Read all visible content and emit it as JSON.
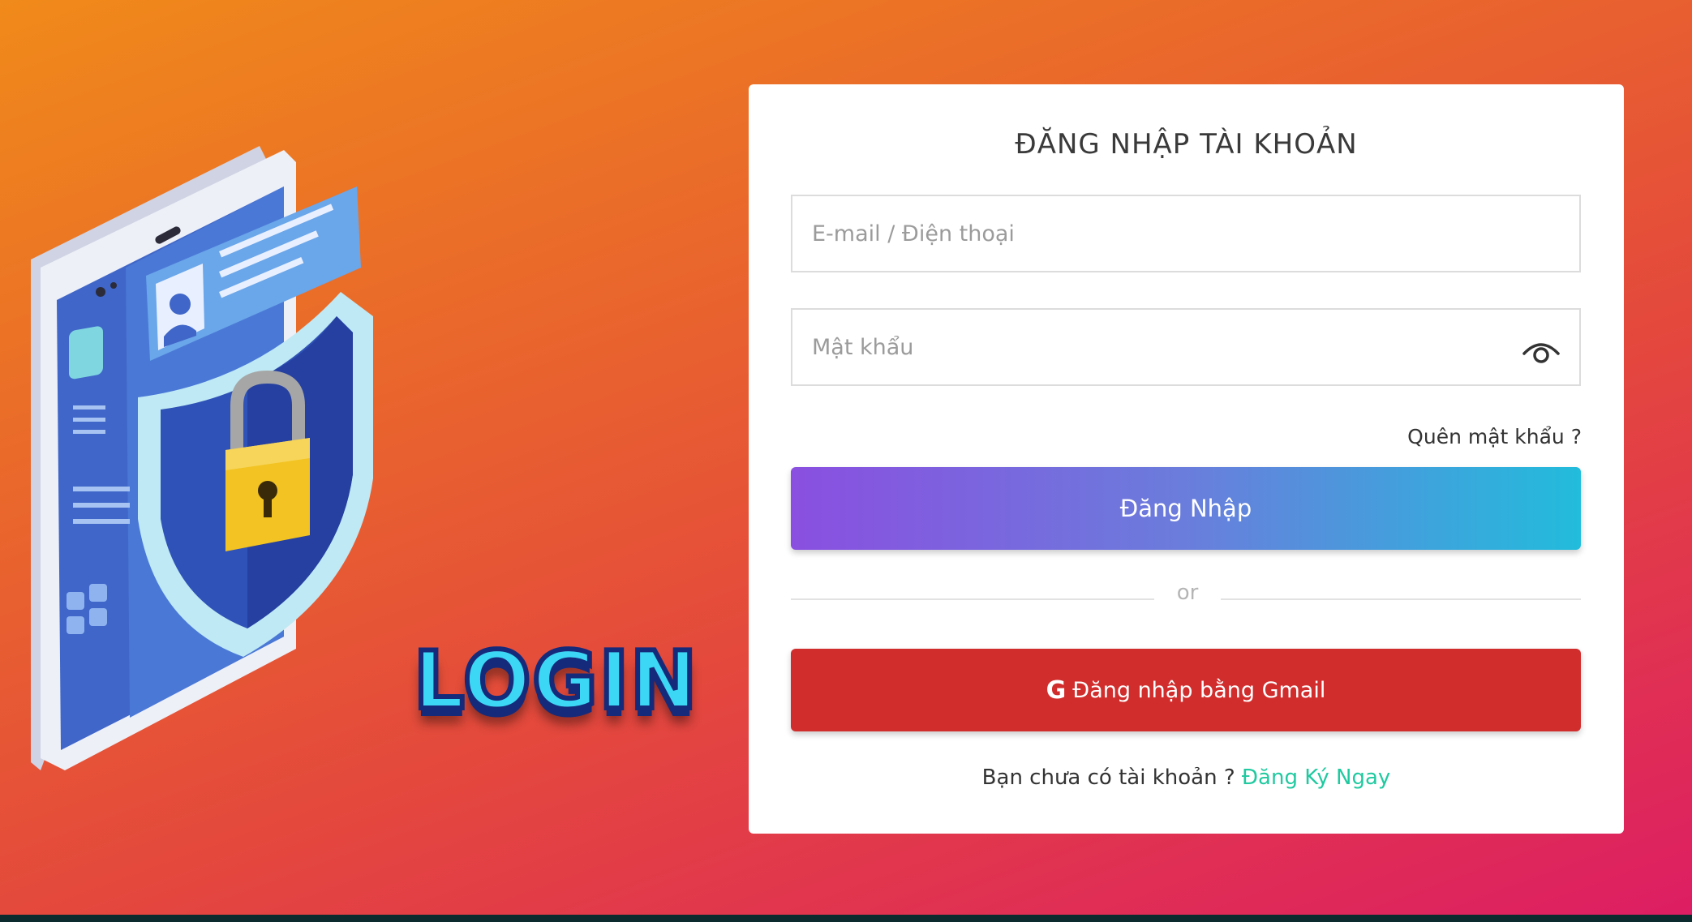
{
  "illustration": {
    "word": "LOGIN"
  },
  "login_form": {
    "title": "ĐĂNG NHẬP TÀI KHOẢN",
    "email_placeholder": "E-mail / Điện thoại",
    "email_value": "",
    "password_placeholder": "Mật khẩu",
    "password_value": "",
    "password_toggle_icon": "eye-icon",
    "forgot_password": "Quên mật khẩu ?",
    "login_button": "Đăng Nhập",
    "divider_text": "or",
    "gmail_icon": "google-icon",
    "gmail_icon_glyph": "G",
    "gmail_button": "Đăng nhập bằng Gmail",
    "signup_prompt": "Bạn chưa có tài khoản ?",
    "signup_link": "Đăng Ký Ngay"
  },
  "colors": {
    "login_gradient_start": "#8a4fe0",
    "login_gradient_end": "#22bcdc",
    "gmail_button": "#d12d2d",
    "signup_link": "#20c9a0",
    "background_start": "#f08a1a",
    "background_end": "#dd1e63"
  }
}
